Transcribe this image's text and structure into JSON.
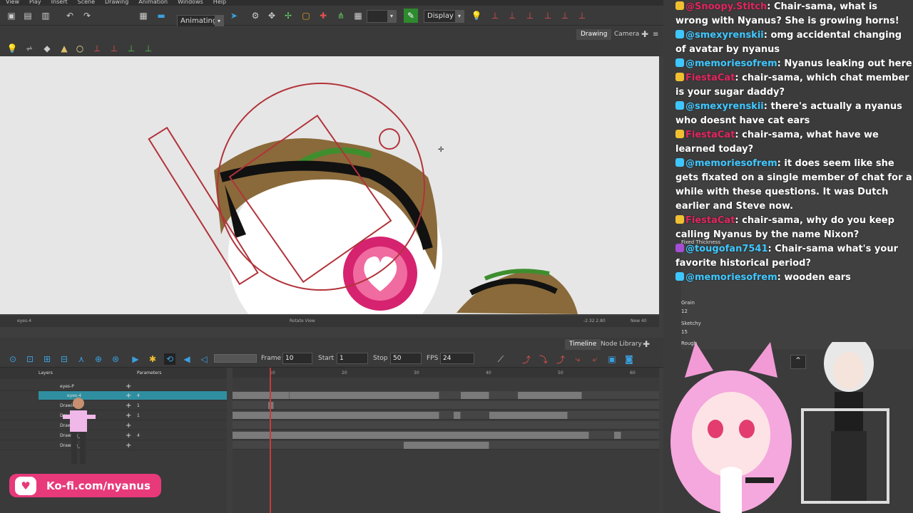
{
  "menu": [
    "View",
    "Play",
    "Insert",
    "Scene",
    "Drawing",
    "Animation",
    "Windows",
    "Help"
  ],
  "toolbar": {
    "mode": "Animating",
    "display": "Display"
  },
  "view_tabs": [
    "Drawing",
    "Camera"
  ],
  "view_status": {
    "layer": "eyes-4",
    "center": "Rotate View",
    "coords": "-2.32 2.80",
    "zoom": "New 40"
  },
  "timeline_tabs": [
    "Timeline",
    "Node Library"
  ],
  "playback": {
    "frame_label": "Frame",
    "frame": "10",
    "start_label": "Start",
    "start": "1",
    "stop_label": "Stop",
    "stop": "50",
    "fps_label": "FPS",
    "fps": "24"
  },
  "layer_header": {
    "layers": "Layers",
    "params": "Parameters"
  },
  "layers": [
    {
      "name": "eyes-P",
      "num": ""
    },
    {
      "name": "eyes-4",
      "num": "4"
    },
    {
      "name": "Drawing",
      "num": "1"
    },
    {
      "name": "Drawing",
      "num": "1"
    },
    {
      "name": "Drawing_2",
      "num": "2"
    },
    {
      "name": "Drawing_2",
      "num": "4"
    },
    {
      "name": "Drawing_3",
      "num": ""
    }
  ],
  "ruler_ticks": [
    "10",
    "20",
    "30",
    "40",
    "50",
    "60"
  ],
  "chat": [
    {
      "user": "@Snoopy.Stitch",
      "color": "#e0245e",
      "text": "Chair-sama, what is wrong with Nyanus? She is growing horns!"
    },
    {
      "user": "@smexyrenskii",
      "color": "#3ec7ff",
      "text": "omg accidental changing of avatar by nyanus"
    },
    {
      "user": "@memoriesofrem",
      "color": "#3ec7ff",
      "text": "Nyanus leaking out here"
    },
    {
      "user": "FiestaCat",
      "color": "#e0245e",
      "text": "chair-sama, which chat member is your sugar daddy?"
    },
    {
      "user": "@smexyrenskii",
      "color": "#3ec7ff",
      "text": "there's actually a nyanus who doesnt have cat ears"
    },
    {
      "user": "FiestaCat",
      "color": "#e0245e",
      "text": "chair-sama, what have we learned today?"
    },
    {
      "user": "@memoriesofrem",
      "color": "#3ec7ff",
      "text": "it does seem like she gets fixated on a single member of chat for a while with these questions. It was Dutch earlier and Steve now."
    },
    {
      "user": "FiestaCat",
      "color": "#e0245e",
      "text": "chair-sama, why do you keep calling Nyanus by the name Nixon?"
    },
    {
      "user": "@tougofan7541",
      "color": "#3ec7ff",
      "text": "Chair-sama what's your favorite historical period?"
    },
    {
      "user": "@memoriesofrem",
      "color": "#3ec7ff",
      "text": "wooden ears"
    }
  ],
  "brushes": [
    "Fixed Thickness",
    "Grain",
    "Sketchy",
    "Rough"
  ],
  "brush_nums": [
    "12",
    "15"
  ],
  "kofi": {
    "text": "Ko-fi.com/nyanus"
  },
  "colors": {
    "accent": "#e8397a",
    "selection": "#2f8fa0",
    "guide": "#b2333a"
  }
}
